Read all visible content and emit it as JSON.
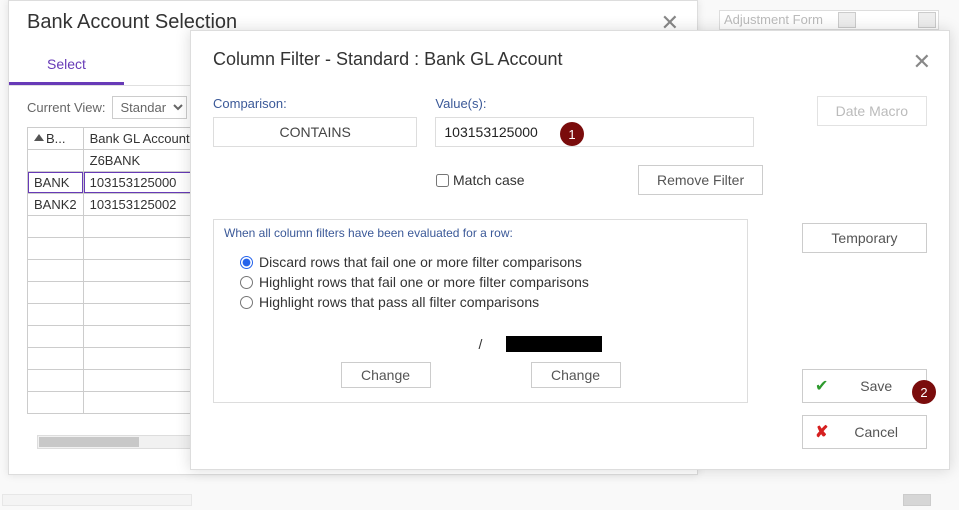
{
  "back": {
    "title": "Bank Account Selection",
    "tab": "Select",
    "view_label": "Current View:",
    "view_value": "Standard",
    "cols": {
      "b": "B...",
      "gl": "Bank GL Account"
    },
    "rows": [
      {
        "b": "",
        "gl": "Z6BANK"
      },
      {
        "b": "BANK",
        "gl": "103153125000"
      },
      {
        "b": "BANK2",
        "gl": "103153125002"
      }
    ]
  },
  "topright_text": "Adjustment Form",
  "dialog": {
    "title": "Column Filter - Standard : Bank GL Account",
    "comparison_label": "Comparison:",
    "comparison_value": "CONTAINS",
    "values_label": "Value(s):",
    "values_value": "103153125000",
    "date_macro": "Date Macro",
    "match_case": "Match case",
    "remove_filter": "Remove Filter",
    "opts_title": "When all column filters have been evaluated for a row:",
    "opt1": "Discard rows that fail one or more filter comparisons",
    "opt2": "Highlight rows that fail one or more filter comparisons",
    "opt3": "Highlight rows that pass all filter comparisons",
    "slash": "/",
    "change": "Change",
    "temporary": "Temporary",
    "save": "Save",
    "cancel": "Cancel"
  },
  "badges": {
    "one": "1",
    "two": "2"
  }
}
